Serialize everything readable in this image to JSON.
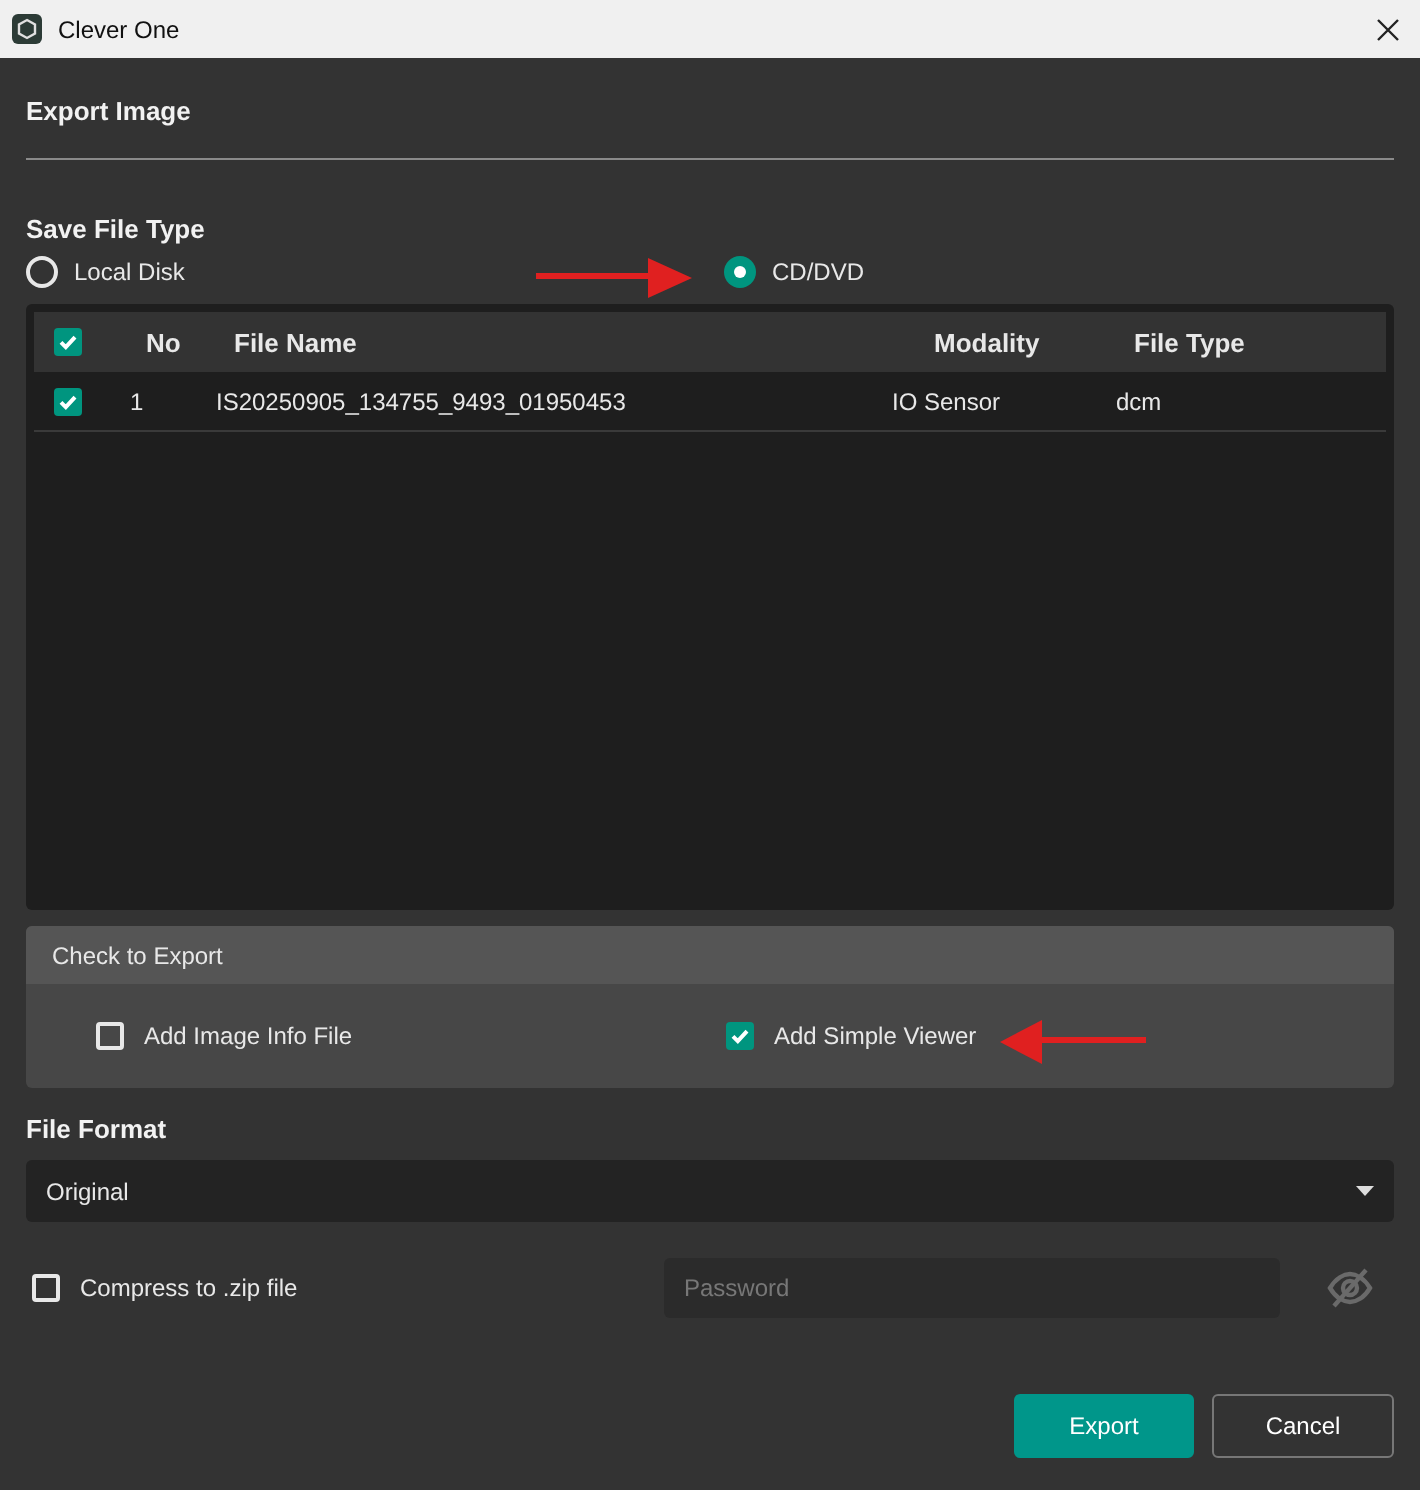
{
  "window": {
    "title": "Clever One"
  },
  "dialog_title": "Export Image",
  "save_file_type": {
    "label": "Save File Type",
    "options": [
      {
        "label": "Local Disk",
        "selected": false
      },
      {
        "label": "CD/DVD",
        "selected": true
      }
    ]
  },
  "table": {
    "all_checked": true,
    "columns": [
      "No",
      "File Name",
      "Modality",
      "File Type"
    ],
    "rows": [
      {
        "checked": true,
        "cells": [
          "1",
          "IS20250905_134755_9493_01950453",
          "IO Sensor",
          "dcm"
        ]
      }
    ]
  },
  "check_to_export": {
    "title": "Check to Export",
    "options": [
      {
        "label": "Add Image Info File",
        "checked": false
      },
      {
        "label": "Add Simple Viewer",
        "checked": true
      }
    ]
  },
  "file_format": {
    "label": "File Format",
    "value": "Original"
  },
  "compress": {
    "label": "Compress to .zip file",
    "checked": false
  },
  "password": {
    "placeholder": "Password"
  },
  "buttons": [
    {
      "label": "Export",
      "kind": "primary"
    },
    {
      "label": "Cancel",
      "kind": "secondary"
    }
  ]
}
